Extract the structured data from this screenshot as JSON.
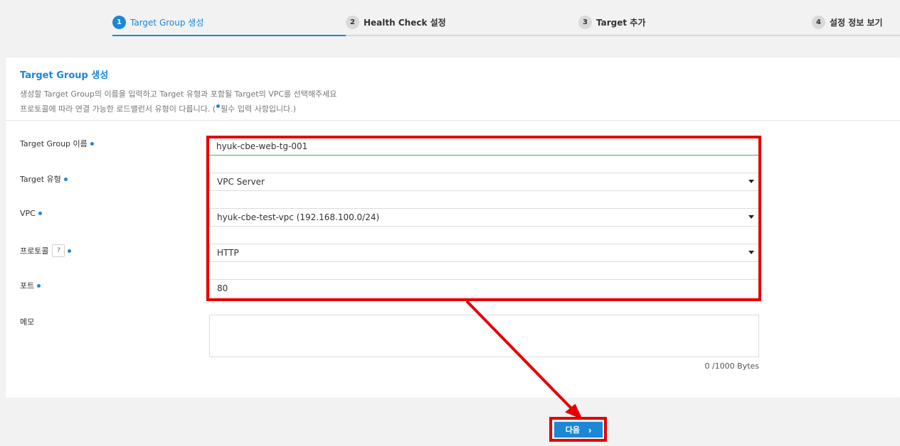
{
  "stepper": {
    "steps": [
      {
        "num": "1",
        "label": "Target Group 생성"
      },
      {
        "num": "2",
        "label": "Health Check 설정"
      },
      {
        "num": "3",
        "label": "Target 추가"
      },
      {
        "num": "4",
        "label": "설정 정보 보기"
      }
    ],
    "active_step": 1
  },
  "card": {
    "title": "Target Group 생성",
    "desc_line1": "생성할 Target Group의 이름을 입력하고 Target 유형과 포함될 Target의 VPC를 선택해주세요",
    "desc_line2_pre": "프로토콜에 따라 연결 가능한 로드밸런서 유형이 다릅니다. (",
    "desc_line2_post": "필수 입력 사항입니다.)"
  },
  "form": {
    "name_label": "Target Group 이름",
    "name_value": "hyuk-cbe-web-tg-001",
    "type_label": "Target 유형",
    "type_value": "VPC Server",
    "vpc_label": "VPC",
    "vpc_value": "hyuk-cbe-test-vpc (192.168.100.0/24)",
    "protocol_label": "프로토콜",
    "protocol_help": "?",
    "protocol_value": "HTTP",
    "port_label": "포트",
    "port_value": "80",
    "memo_label": "메모",
    "memo_value": "",
    "bytes_counter": "0 /1000 Bytes"
  },
  "footer": {
    "next_label": "다음",
    "next_icon": "chevron-right-icon"
  },
  "colors": {
    "accent": "#1b87d6",
    "annotation": "#e50000",
    "valid": "#4caf50"
  }
}
